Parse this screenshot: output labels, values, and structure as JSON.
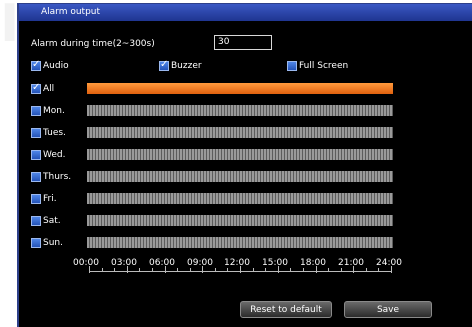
{
  "window": {
    "title": "Alarm output"
  },
  "alarm_time": {
    "label": "Alarm during time(2~300s)",
    "value": "30"
  },
  "options": [
    {
      "label": "Audio",
      "checked": true
    },
    {
      "label": "Buzzer",
      "checked": true
    },
    {
      "label": "Full Screen",
      "checked": false
    }
  ],
  "schedule": {
    "rows": [
      {
        "label": "All",
        "checked": true
      },
      {
        "label": "Mon.",
        "checked": false
      },
      {
        "label": "Tues.",
        "checked": false
      },
      {
        "label": "Wed.",
        "checked": false
      },
      {
        "label": "Thurs.",
        "checked": false
      },
      {
        "label": "Fri.",
        "checked": false
      },
      {
        "label": "Sat.",
        "checked": false
      },
      {
        "label": "Sun.",
        "checked": false
      }
    ],
    "ticks": [
      "00:00",
      "03:00",
      "06:00",
      "09:00",
      "12:00",
      "15:00",
      "18:00",
      "21:00",
      "24:00"
    ]
  },
  "buttons": {
    "reset": "Reset to default",
    "save": "Save"
  },
  "colors": {
    "selected_bar": "#ff8c2a",
    "unselected_bar": "#8a8a8a",
    "titlebar": "#2d4bb0"
  }
}
